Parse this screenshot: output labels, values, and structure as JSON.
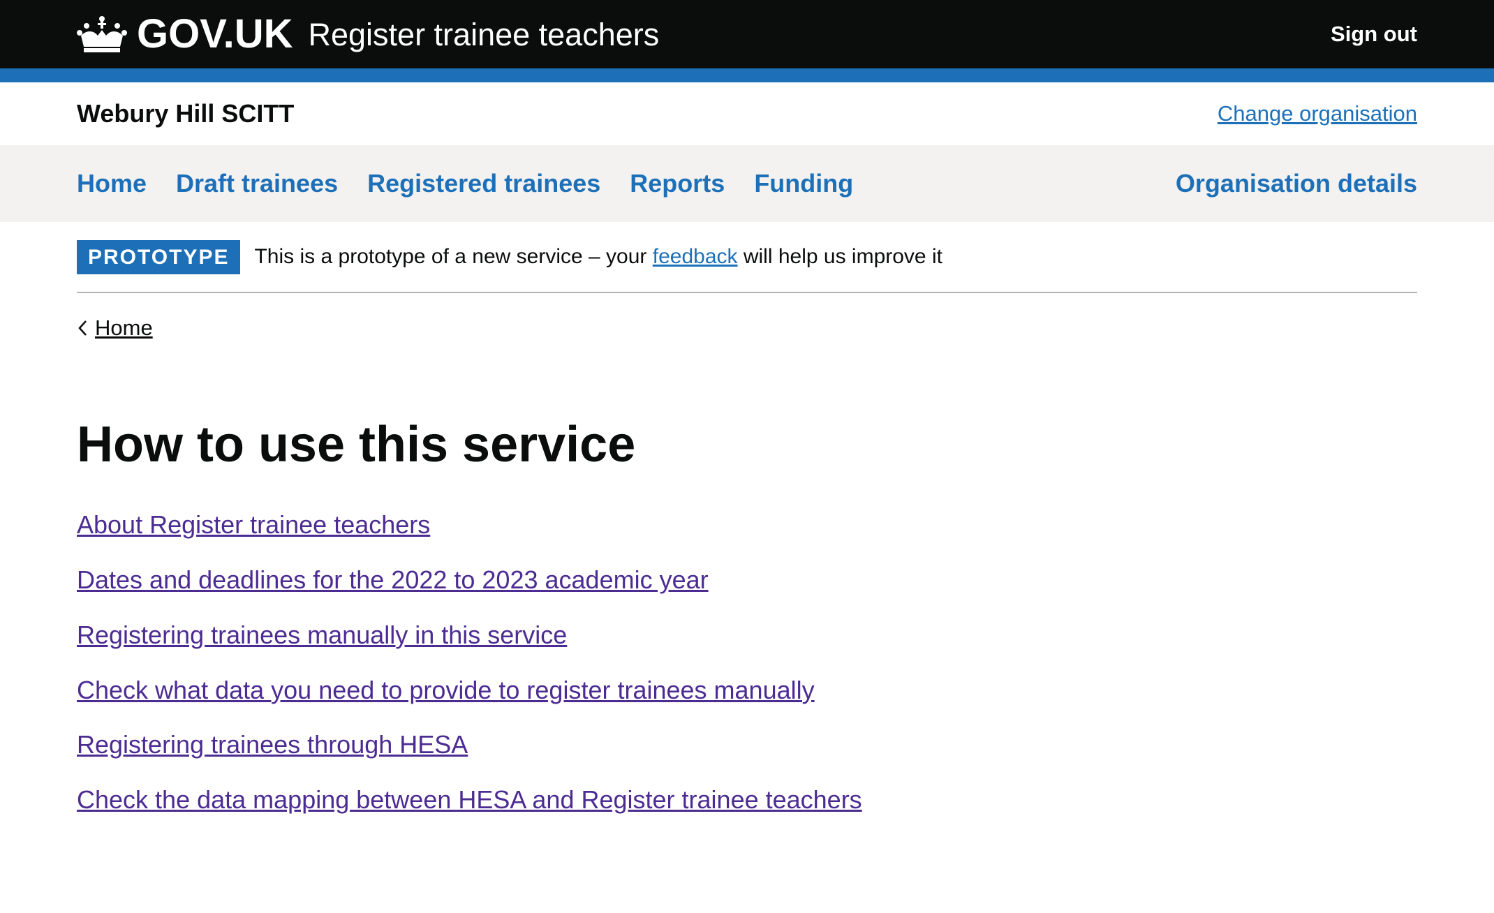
{
  "header": {
    "logo_text": "GOV.UK",
    "service_name": "Register trainee teachers",
    "sign_out": "Sign out"
  },
  "org_bar": {
    "organisation": "Webury Hill SCITT",
    "change_link": "Change organisation"
  },
  "nav": {
    "items": [
      "Home",
      "Draft trainees",
      "Registered trainees",
      "Reports",
      "Funding"
    ],
    "right_item": "Organisation details"
  },
  "phase_banner": {
    "tag": "PROTOTYPE",
    "text_before": "This is a prototype of a new service – your ",
    "link": "feedback",
    "text_after": " will help us improve it"
  },
  "breadcrumb": {
    "back_label": "Home"
  },
  "main": {
    "title": "How to use this service",
    "links": [
      "About Register trainee teachers",
      "Dates and deadlines for the 2022 to 2023 academic year",
      "Registering trainees manually in this service",
      "Check what data you need to provide to register trainees manually",
      "Registering trainees through HESA",
      "Check the data mapping between HESA and Register trainee teachers"
    ]
  },
  "colors": {
    "header_bg": "#0b0c0c",
    "brand_blue": "#1d70b8",
    "visited_link": "#4c2c92",
    "nav_bg": "#f3f2f1"
  },
  "icons": [
    "crown-icon",
    "chevron-left-icon"
  ]
}
